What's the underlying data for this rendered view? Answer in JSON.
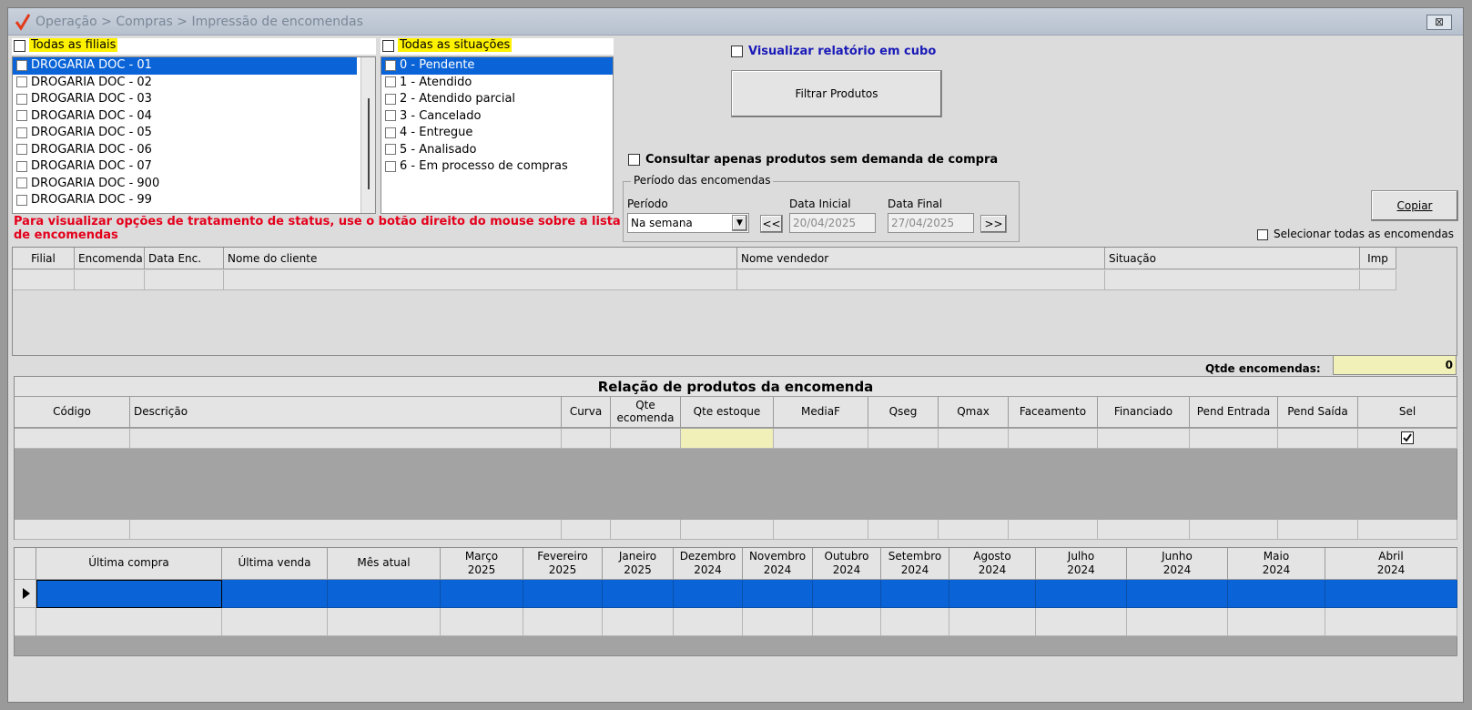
{
  "window": {
    "title": "Operação > Compras > Impressão de encomendas",
    "close_label": "⊠"
  },
  "filiais": {
    "all_label": "Todas as filiais",
    "items": [
      "DROGARIA DOC - 01",
      "DROGARIA DOC - 02",
      "DROGARIA DOC - 03",
      "DROGARIA DOC - 04",
      "DROGARIA DOC - 05",
      "DROGARIA DOC - 06",
      "DROGARIA DOC - 07",
      "DROGARIA DOC - 900",
      "DROGARIA DOC - 99"
    ]
  },
  "situacoes": {
    "all_label": "Todas as situações",
    "items": [
      "0 - Pendente",
      "1 - Atendido",
      "2 - Atendido parcial",
      "3 - Cancelado",
      "4 - Entregue",
      "5 - Analisado",
      "6 - Em processo de compras"
    ]
  },
  "controls": {
    "cubo_label": "Visualizar relatório em cubo",
    "filtrar_label": "Filtrar Produtos",
    "sem_demanda_label": "Consultar apenas produtos sem demanda de compra",
    "copiar_label": "Copiar",
    "selecionar_todas_label": "Selecionar todas as encomendas",
    "warning": "Para visualizar opções de tratamento de status, use o botão direito do mouse sobre a lista de encomendas"
  },
  "periodo": {
    "group_label": "Período das encomendas",
    "periodo_label": "Período",
    "periodo_value": "Na semana",
    "data_inicial_label": "Data Inicial",
    "data_inicial_value": "20/04/2025",
    "data_final_label": "Data Final",
    "data_final_value": "27/04/2025",
    "prev_label": "<<",
    "next_label": ">>"
  },
  "orders_grid": {
    "columns": [
      "Filial",
      "Encomenda",
      "Data Enc.",
      "Nome do cliente",
      "Nome vendedor",
      "Situação",
      "Imp"
    ]
  },
  "qtde": {
    "label": "Qtde encomendas:",
    "value": "0"
  },
  "products": {
    "title": "Relação de produtos da encomenda",
    "columns": [
      "Código",
      "Descrição",
      "Curva",
      "Qte\necomenda",
      "Qte estoque",
      "MediaF",
      "Qseg",
      "Qmax",
      "Faceamento",
      "Financiado",
      "Pend Entrada",
      "Pend Saída",
      "Sel"
    ]
  },
  "history": {
    "columns": [
      "Última compra",
      "Última venda",
      "Mês atual",
      "Março\n2025",
      "Fevereiro\n2025",
      "Janeiro\n2025",
      "Dezembro\n2024",
      "Novembro\n2024",
      "Outubro\n2024",
      "Setembro\n2024",
      "Agosto\n2024",
      "Julho\n2024",
      "Junho\n2024",
      "Maio\n2024",
      "Abril\n2024"
    ]
  },
  "colors": {
    "selection": "#0a64d7",
    "highlight": "#fff200",
    "warning": "#e4001b",
    "link_blue": "#1a1ab8",
    "qtde_field": "#f0f0b8"
  }
}
